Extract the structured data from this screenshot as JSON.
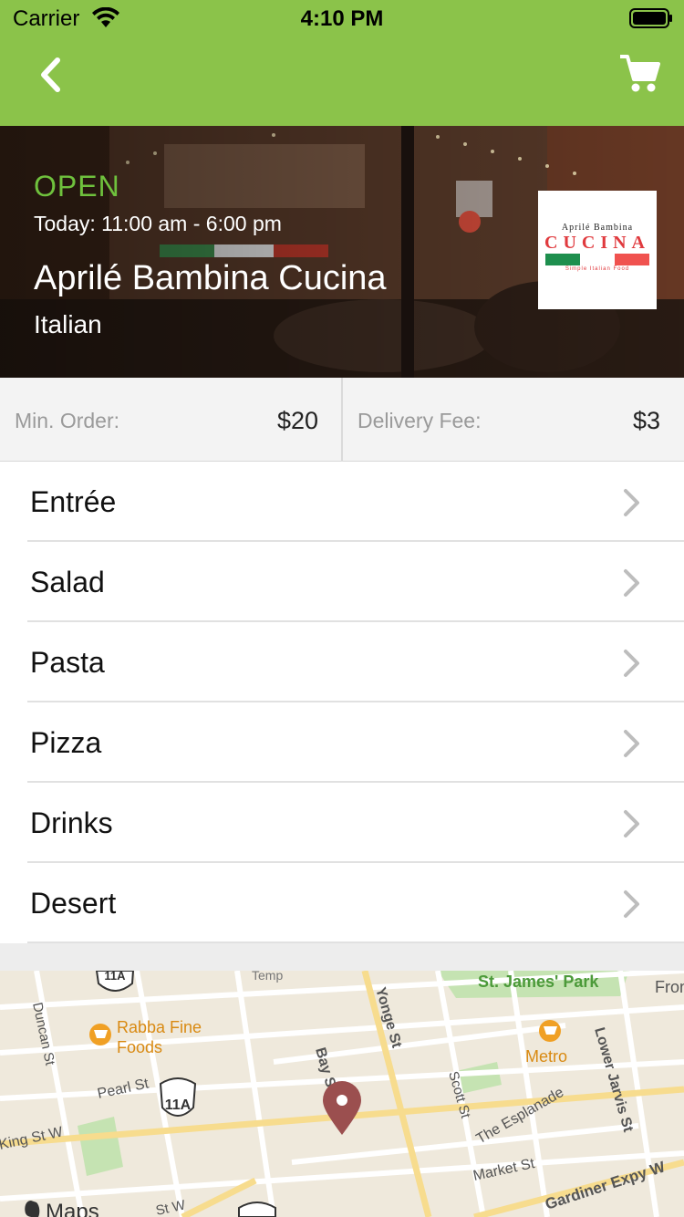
{
  "status_bar": {
    "carrier": "Carrier",
    "time": "4:10 PM"
  },
  "nav": {
    "back_icon": "chevron-left-icon",
    "cart_icon": "cart-icon"
  },
  "restaurant": {
    "status": "OPEN",
    "hours": "Today: 11:00 am - 6:00 pm",
    "name": "Aprilé Bambina Cucina",
    "cuisine": "Italian",
    "logo": {
      "line1": "Aprilé Bambina",
      "line2": "CUCINA",
      "line3": "Simple Italian Food"
    }
  },
  "order_info": {
    "min_order_label": "Min. Order:",
    "min_order_value": "$20",
    "delivery_fee_label": "Delivery Fee:",
    "delivery_fee_value": "$3"
  },
  "menu": {
    "categories": [
      {
        "label": "Entrée"
      },
      {
        "label": "Salad"
      },
      {
        "label": "Pasta"
      },
      {
        "label": "Pizza"
      },
      {
        "label": "Drinks"
      },
      {
        "label": "Desert"
      }
    ]
  },
  "map": {
    "labels": {
      "st_james_park": "St. James' Park",
      "rabba_1": "Rabba Fine",
      "rabba_2": "Foods",
      "metro": "Metro",
      "yonge": "Yonge St",
      "bay": "Bay St",
      "scott": "Scott St",
      "lower_jarvis": "Lower Jarvis St",
      "esplanade": "The Esplanade",
      "market": "Market St",
      "gardiner": "Gardiner Expy W",
      "duncan": "Duncan St",
      "pearl": "Pearl St",
      "king": "King St W",
      "front": "Front",
      "temple": "Temp",
      "route_11a": "11A",
      "route_11a_top": "11A",
      "maps_attribution": "Maps",
      "st_w": "St W"
    },
    "colors": {
      "park": "#c5e3b2",
      "road": "#ffffff",
      "major_road": "#f7dc8e",
      "pin": "#9b4f4f",
      "poi": "#f0a024"
    }
  },
  "colors": {
    "header": "#8bc34a",
    "open_status": "#6fc13d"
  }
}
